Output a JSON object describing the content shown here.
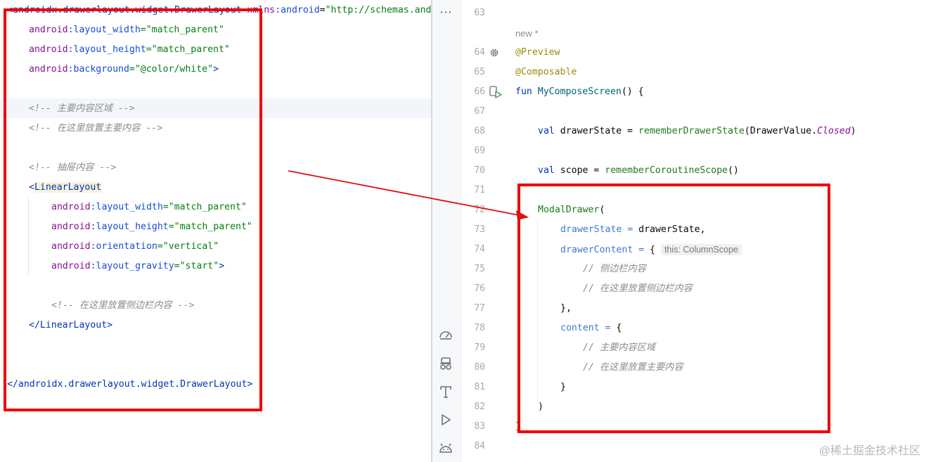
{
  "xml_editor": {
    "lines": {
      "l1_open": "<",
      "l1_tag": "androidx.drawerlayout.widget.DrawerLayout",
      "l1_attr_ns": " xmlns",
      "l1_attr_ns2": ":android",
      "l1_eq": "=",
      "l1_val": "\"http://schemas.andr",
      "a1_ns": "android",
      "a1_name": ":layout_width",
      "a1_val": "=\"match_parent\"",
      "a2_ns": "android",
      "a2_name": ":layout_height",
      "a2_val": "=\"match_parent\"",
      "a3_ns": "android",
      "a3_name": ":background",
      "a3_val": "=\"@color/white\"",
      "a3_close": ">",
      "c1": "<!-- 主要内容区域 -->",
      "c2": "<!-- 在这里放置主要内容 -->",
      "c3": "<!-- 抽屉内容 -->",
      "ll_open": "<",
      "ll_tag": "LinearLayout",
      "b1_ns": "android",
      "b1_name": ":layout_width",
      "b1_val": "=\"match_parent\"",
      "b2_ns": "android",
      "b2_name": ":layout_height",
      "b2_val": "=\"match_parent\"",
      "b3_ns": "android",
      "b3_name": ":orientation",
      "b3_val": "=\"vertical\"",
      "b4_ns": "android",
      "b4_name": ":layout_gravity",
      "b4_val": "=\"start\"",
      "b4_close": ">",
      "c4": "<!-- 在这里放置侧边栏内容 -->",
      "ll_close": "</LinearLayout>",
      "dl_close": "</androidx.drawerlayout.widget.DrawerLayout>"
    }
  },
  "toolbar": {
    "more_label": "⋯",
    "icons": [
      "more-icon",
      "performance-icon",
      "inspector-icon",
      "text-format-icon",
      "run-icon",
      "android-icon"
    ]
  },
  "kotlin_editor": {
    "line_numbers": [
      "63",
      "64",
      "65",
      "66",
      "67",
      "68",
      "69",
      "70",
      "71",
      "72",
      "73",
      "74",
      "75",
      "76",
      "77",
      "78",
      "79",
      "80",
      "81",
      "82",
      "83",
      "84"
    ],
    "new_label": "new *",
    "code": {
      "l64": "@Preview",
      "l65": "@Composable",
      "l66_kw": "fun ",
      "l66_name": "MyComposeScreen",
      "l66_rest": "() {",
      "l68_kw": "val ",
      "l68_id": "drawerState",
      "l68_eq": " = ",
      "l68_fn": "rememberDrawerState",
      "l68_p1": "(DrawerValue.",
      "l68_enum": "Closed",
      "l68_p2": ")",
      "l70_kw": "val ",
      "l70_id": "scope",
      "l70_eq": " = ",
      "l70_fn": "rememberCoroutineScope",
      "l70_p": "()",
      "l72_fn": "ModalDrawer",
      "l72_p": "(",
      "l73_param": "drawerState",
      "l73_eq": " = ",
      "l73_val": "drawerState,",
      "l74_param": "drawerContent",
      "l74_eq": " = ",
      "l74_brace": "{ ",
      "l74_hint": "this: ColumnScope",
      "l75": "// 侧边栏内容",
      "l76": "// 在这里放置侧边栏内容",
      "l77": "},",
      "l78_param": "content",
      "l78_eq": " = ",
      "l78_brace": "{",
      "l79": "// 主要内容区域",
      "l80": "// 在这里放置主要内容",
      "l81": "}",
      "l82": ")",
      "l83": "}"
    }
  },
  "watermark": "@稀土掘金技术社区",
  "colors": {
    "annotation_box": "#f00000",
    "arrow": "#e01010"
  }
}
